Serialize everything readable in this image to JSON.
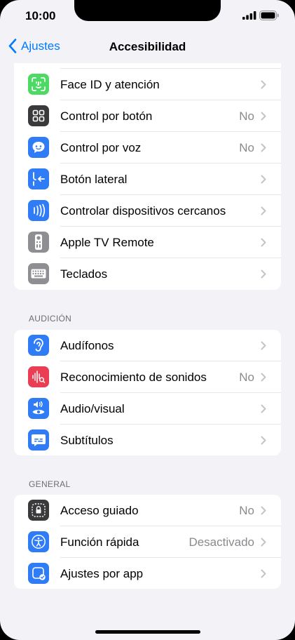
{
  "status_bar": {
    "time": "10:00"
  },
  "nav": {
    "back_label": "Ajustes",
    "title": "Accesibilidad"
  },
  "groups": {
    "top": [
      {
        "label": "Face ID y atención",
        "value": "",
        "icon": "face-id-icon",
        "color": "#4cd964"
      },
      {
        "label": "Control por botón",
        "value": "No",
        "icon": "grid-icon",
        "color": "#3a3a3c"
      },
      {
        "label": "Control por voz",
        "value": "No",
        "icon": "voice-control-icon",
        "color": "#2f7cf6"
      },
      {
        "label": "Botón lateral",
        "value": "",
        "icon": "side-button-icon",
        "color": "#2f7cf6"
      },
      {
        "label": "Controlar dispositivos cercanos",
        "value": "",
        "icon": "nearby-devices-icon",
        "color": "#2f7cf6"
      },
      {
        "label": "Apple TV Remote",
        "value": "",
        "icon": "remote-icon",
        "color": "#8e8e93"
      },
      {
        "label": "Teclados",
        "value": "",
        "icon": "keyboard-icon",
        "color": "#8e8e93"
      }
    ],
    "hearing": {
      "header": "AUDICIÓN",
      "items": [
        {
          "label": "Audífonos",
          "value": "",
          "icon": "ear-icon",
          "color": "#2f7cf6"
        },
        {
          "label": "Reconocimiento de sonidos",
          "value": "No",
          "icon": "sound-recognition-icon",
          "color": "#ea3e55"
        },
        {
          "label": "Audio/visual",
          "value": "",
          "icon": "audio-visual-icon",
          "color": "#2f7cf6"
        },
        {
          "label": "Subtítulos",
          "value": "",
          "icon": "subtitles-icon",
          "color": "#2f7cf6"
        }
      ]
    },
    "general": {
      "header": "GENERAL",
      "items": [
        {
          "label": "Acceso guiado",
          "value": "No",
          "icon": "guided-access-icon",
          "color": "#3a3a3c"
        },
        {
          "label": "Función rápida",
          "value": "Desactivado",
          "icon": "accessibility-shortcut-icon",
          "color": "#2f7cf6"
        },
        {
          "label": "Ajustes por app",
          "value": "",
          "icon": "per-app-settings-icon",
          "color": "#2f7cf6"
        }
      ]
    }
  }
}
